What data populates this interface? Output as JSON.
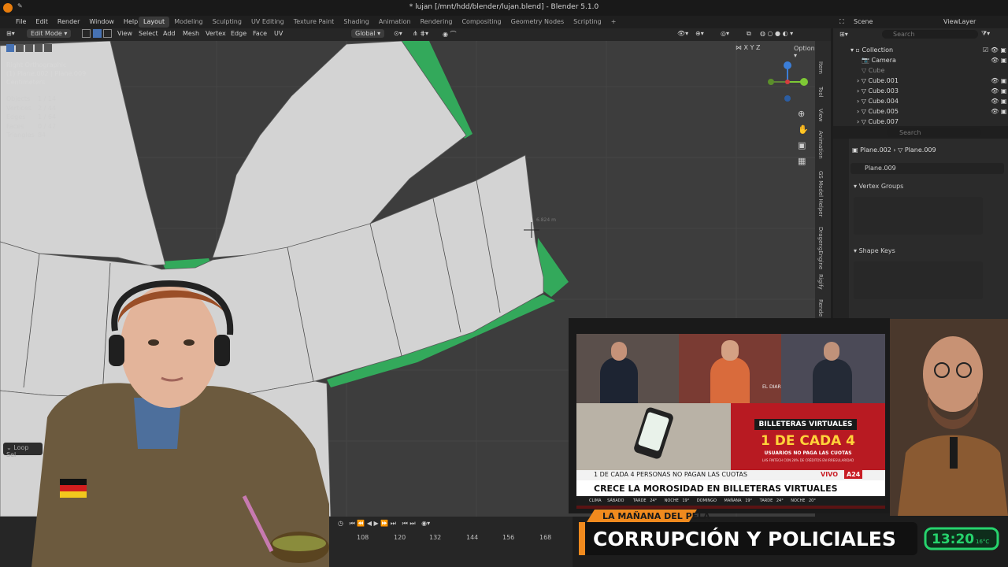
{
  "window": {
    "title": "* lujan [/mnt/hdd/blender/lujan.blend] - Blender 5.1.0"
  },
  "menu": [
    "File",
    "Edit",
    "Render",
    "Window",
    "Help"
  ],
  "workspaces": [
    "Layout",
    "Modeling",
    "Sculpting",
    "UV Editing",
    "Texture Paint",
    "Shading",
    "Animation",
    "Rendering",
    "Compositing",
    "Geometry Nodes",
    "Scripting"
  ],
  "active_workspace": "Layout",
  "viewport_header": {
    "mode": "Edit Mode",
    "menus": [
      "View",
      "Select",
      "Add",
      "Mesh",
      "Vertex",
      "Edge",
      "Face",
      "UV"
    ],
    "transform": "Global",
    "options": "Options",
    "axes": [
      "X",
      "Y",
      "Z"
    ]
  },
  "viewport_info": {
    "view": "Right Orthographic",
    "object": "(1) Plane.002 | Plane.009",
    "units": "Centimeters"
  },
  "stats": [
    {
      "label": "Objects",
      "value": "1 / 14"
    },
    {
      "label": "Vertices",
      "value": "2 / 44"
    },
    {
      "label": "Edges",
      "value": "1 / 64"
    },
    {
      "label": "Faces",
      "value": "0 / 42"
    },
    {
      "label": "Triangles",
      "value": "84"
    }
  ],
  "measure": "6.824 m",
  "sidebar_tabs": [
    "Item",
    "Tool",
    "View",
    "Animation",
    "GS Model Helper",
    "DragengEngine",
    "Rigify",
    "Rende"
  ],
  "scene": {
    "label": "Scene",
    "view_layer": "ViewLayer",
    "search_placeholder": "Search"
  },
  "outliner": {
    "collection": "Collection",
    "items": [
      "Camera",
      "Cube",
      "Cube.001",
      "Cube.003",
      "Cube.004",
      "Cube.005",
      "Cube.007"
    ]
  },
  "properties": {
    "breadcrumb_object": "Plane.002",
    "breadcrumb_mesh": "Plane.009",
    "mesh_name": "Plane.009",
    "search_placeholder": "Search",
    "panels": [
      "Vertex Groups",
      "Shape Keys"
    ]
  },
  "operator_panel": "Loop Sel",
  "timeline": {
    "frames": [
      "108",
      "120",
      "132",
      "144",
      "156",
      "168"
    ]
  },
  "overlay": {
    "tv": {
      "channel_tag": "EL DIAR",
      "headline_tag": "BILLETERAS VIRTUALES",
      "big_stat": "1 DE CADA 4",
      "sub_stat": "USUARIOS NO PAGA LAS CUOTAS",
      "fine_print": "LAS FINTECH CON 28% DE CRÉDITOS EN IRREGULARIDAD",
      "ticker_top": "1 DE CADA 4 PERSONAS NO PAGAN LAS CUOTAS",
      "live": "VIVO",
      "channel": "A24",
      "ticker_main": "CRECE LA MOROSIDAD EN BILLETERAS VIRTUALES",
      "weather_label": "CLIMA",
      "weather_items": [
        "SÁBADO",
        "TARDE",
        "24°",
        "NOCHE",
        "19°",
        "DOMINGO",
        "MAÑANA",
        "19°",
        "TARDE",
        "24°",
        "NOCHE",
        "20°"
      ]
    },
    "show_name": "LA MAÑANA DEL PELA",
    "segment_title": "CORRUPCIÓN Y POLICIALES",
    "clock": "13:20",
    "temperature": "16°C"
  },
  "colors": {
    "accent_blue": "#4772b3",
    "mesh_face": "#d3d3d3",
    "mesh_edge_green": "#33a95b",
    "overlay_orange": "#f08a1e",
    "overlay_green": "#26d46d",
    "tv_red": "#c81d25"
  }
}
